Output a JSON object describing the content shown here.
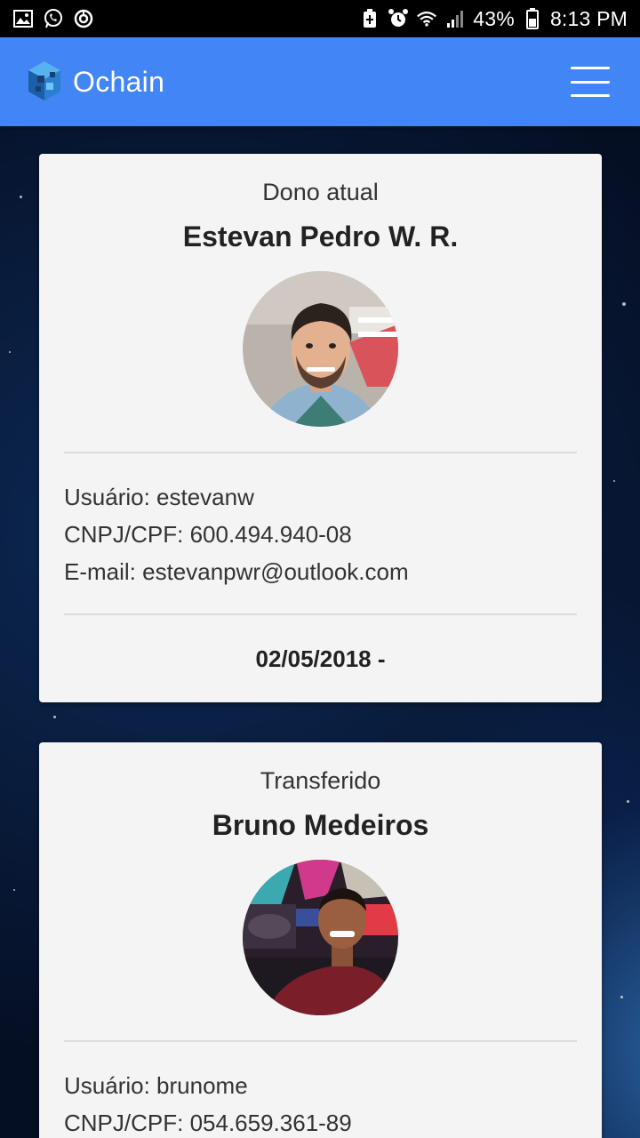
{
  "status_bar": {
    "battery": "43%",
    "time": "8:13 PM",
    "left_icons": [
      "image-icon",
      "whatsapp-icon",
      "sync-icon"
    ],
    "right_icons": [
      "battery-saver-icon",
      "alarm-icon",
      "wifi-icon",
      "signal-icon",
      "battery-icon"
    ]
  },
  "app_bar": {
    "title": "Ochain",
    "logo_icon": "ochain-logo-icon",
    "menu_icon": "hamburger-menu-icon",
    "color": "#4285f4"
  },
  "owners": [
    {
      "role": "Dono atual",
      "name": "Estevan Pedro W. R.",
      "user_line": "Usuário: estevanw",
      "doc_line": "CNPJ/CPF: 600.494.940-08",
      "email_line": "E-mail: estevanpwr@outlook.com",
      "date": "02/05/2018 -"
    },
    {
      "role": "Transferido",
      "name": "Bruno Medeiros",
      "user_line": "Usuário: brunome",
      "doc_line": "CNPJ/CPF: 054.659.361-89"
    }
  ]
}
